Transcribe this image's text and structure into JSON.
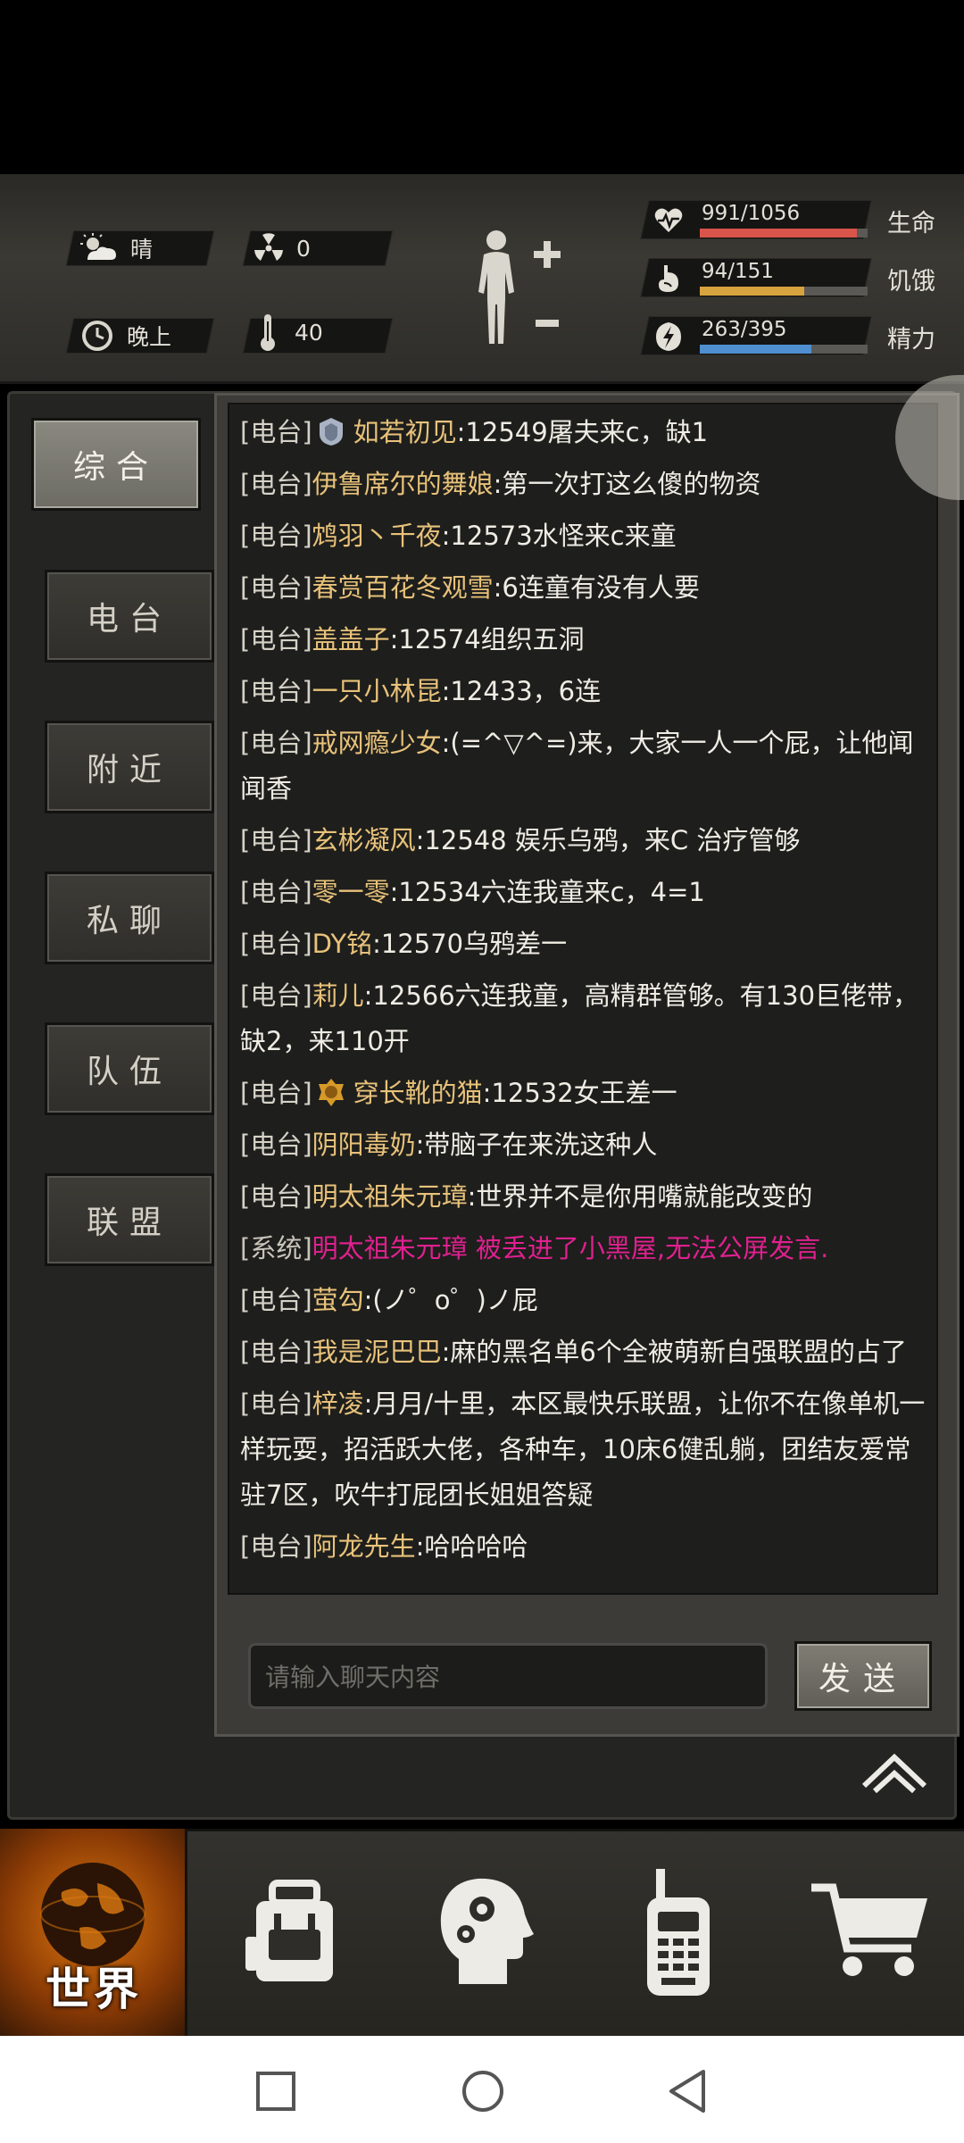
{
  "header": {
    "weather": "晴",
    "radiation": "0",
    "time_of_day": "晚上",
    "temperature": "40",
    "vitals": [
      {
        "label": "生命",
        "value": "991/1056",
        "fraction": 0.938,
        "color": "#d9544a",
        "icon": "heart-rate-icon"
      },
      {
        "label": "饥饿",
        "value": "94/151",
        "fraction": 0.623,
        "color": "#d6a33e",
        "icon": "stomach-icon"
      },
      {
        "label": "精力",
        "value": "263/395",
        "fraction": 0.666,
        "color": "#4f8fd0",
        "icon": "energy-bolt-icon"
      }
    ]
  },
  "sidebar": {
    "tabs": [
      {
        "label": "综合",
        "active": true
      },
      {
        "label": "电台",
        "active": false
      },
      {
        "label": "附近",
        "active": false
      },
      {
        "label": "私聊",
        "active": false
      },
      {
        "label": "队伍",
        "active": false
      },
      {
        "label": "联盟",
        "active": false
      }
    ]
  },
  "chat": {
    "messages": [
      {
        "channel": "[电台]",
        "name": "如若初见",
        "text": ":12549屠夫来c，缺1",
        "badge": "silver"
      },
      {
        "channel": "[电台]",
        "name": "伊鲁席尔的舞娘",
        "text": ":第一次打这么傻的物资"
      },
      {
        "channel": "[电台]",
        "name": "鸩羽丶千夜",
        "text": ":12573水怪来c来童"
      },
      {
        "channel": "[电台]",
        "name": "春赏百花冬观雪",
        "text": ":6连童有没有人要"
      },
      {
        "channel": "[电台]",
        "name": "盖盖子",
        "text": ":12574组织五洞"
      },
      {
        "channel": "[电台]",
        "name": "一只小林昆",
        "text": ":12433，6连"
      },
      {
        "channel": "[电台]",
        "name": "戒网瘾少女",
        "text": ":(=^▽^=)来，大家一人一个屁，让他闻闻香"
      },
      {
        "channel": "[电台]",
        "name": "玄彬凝风",
        "text": ":12548 娱乐乌鸦，来C 治疗管够"
      },
      {
        "channel": "[电台]",
        "name": "零一零",
        "text": ":12534六连我童来c，4=1"
      },
      {
        "channel": "[电台]",
        "name": "DY铭",
        "text": ":12570乌鸦差一"
      },
      {
        "channel": "[电台]",
        "name": "莉儿",
        "text": ":12566六连我童，高精群管够。有130巨佬带，缺2，来110开"
      },
      {
        "channel": "[电台]",
        "name": "穿长靴的猫",
        "text": ":12532女王差一",
        "badge": "gold"
      },
      {
        "channel": "[电台]",
        "name": "阴阳毒奶",
        "text": ":带脑子在来洗这种人"
      },
      {
        "channel": "[电台]",
        "name": "明太祖朱元璋",
        "text": ":世界并不是你用嘴就能改变的"
      },
      {
        "channel": "[系统]",
        "name": "",
        "text": "明太祖朱元璋 被丢进了小黑屋,无法公屏发言.",
        "system": true
      },
      {
        "channel": "[电台]",
        "name": "萤勾",
        "text": ":(ノ゜ο゜)ノ屁"
      },
      {
        "channel": "[电台]",
        "name": "我是泥巴巴",
        "text": ":麻的黑名单6个全被萌新自强联盟的占了"
      },
      {
        "channel": "[电台]",
        "name": "梓凌",
        "text": ":月月/十里，本区最快乐联盟，让你不在像单机一样玩耍，招活跃大佬，各种车，10床6健乱躺，团结友爱常驻7区，吹牛打屁团长姐姐答疑"
      },
      {
        "channel": "[电台]",
        "name": "阿龙先生",
        "text": ":哈哈哈哈"
      }
    ],
    "input_placeholder": "请输入聊天内容",
    "send_label": "发送"
  },
  "bottom_nav": {
    "world_label": "世界",
    "items": [
      "globe-icon",
      "backpack-icon",
      "head-gears-icon",
      "walkie-talkie-icon",
      "shopping-cart-icon"
    ]
  },
  "colors": {
    "name": "#e8c27a",
    "system_text": "#e0208f",
    "accent_orange": "#e07a10"
  }
}
